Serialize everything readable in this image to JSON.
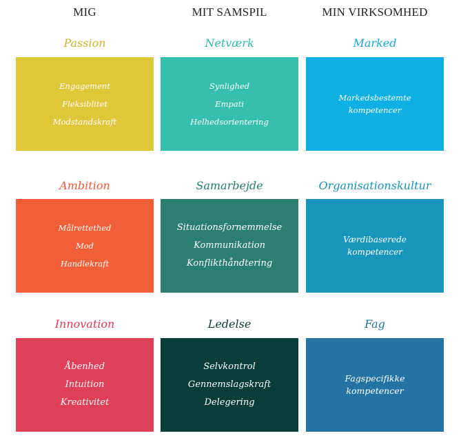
{
  "columns": [
    {
      "header": "MIG",
      "color": "#222222"
    },
    {
      "header": "MIT SAMSPIL",
      "color": "#222222"
    },
    {
      "header": "MIN VIRKSOMHED",
      "color": "#222222"
    }
  ],
  "cells": [
    [
      {
        "title": "Passion",
        "title_color": "#c9b429",
        "bg": "#dfc73a",
        "items": [
          "Engagement",
          "Fleksiblitet",
          "Modstandskraft"
        ]
      },
      {
        "title": "Netværk",
        "title_color": "#2fb9a9",
        "bg": "#36bfae",
        "items": [
          "Synlighed",
          "Empati",
          "Helhedsorientering"
        ]
      },
      {
        "title": "Marked",
        "title_color": "#1aa6d6",
        "bg": "#0eb0e3",
        "items": [
          "Markedsbestemte",
          "kompetencer"
        ]
      }
    ],
    [
      {
        "title": "Ambition",
        "title_color": "#ec5a36",
        "bg": "#f05f37",
        "items": [
          "Målrettethed",
          "Mod",
          "Handlekraft"
        ]
      },
      {
        "title": "Samarbejde",
        "title_color": "#267a6c",
        "bg": "#2b7f71",
        "items": [
          "Situationsfornemmelse",
          "Kommunikation",
          "Konflikthåndtering"
        ]
      },
      {
        "title": "Organisationskultur",
        "title_color": "#1890b8",
        "bg": "#1795bb",
        "items": [
          "Værdibaserede",
          "kompetencer"
        ]
      }
    ],
    [
      {
        "title": "Innovation",
        "title_color": "#dc3c55",
        "bg": "#dd4057",
        "items": [
          "Åbenhed",
          "Intuition",
          "Kreativitet"
        ]
      },
      {
        "title": "Ledelse",
        "title_color": "#0d3a36",
        "bg": "#083d38",
        "items": [
          "Selvkontrol",
          "Gennemslagskraft",
          "Delegering"
        ]
      },
      {
        "title": "Fag",
        "title_color": "#1e6fa0",
        "bg": "#2473a3",
        "items": [
          "Fagspecifikke",
          "kompetencer"
        ]
      }
    ]
  ]
}
